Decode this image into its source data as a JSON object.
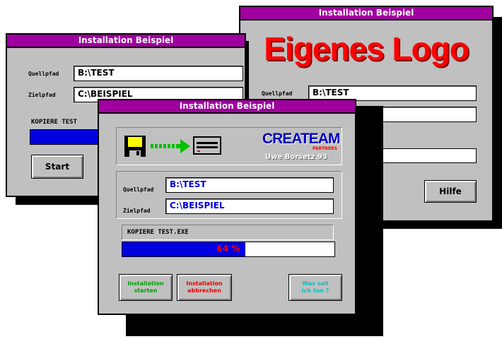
{
  "win_back_left": {
    "title": "Installation Beispiel",
    "source_label": "Quellpfad",
    "source_value": "B:\\TEST",
    "target_label": "Zielpfad",
    "target_value": "C:\\BEISPIEL",
    "status": "KOPIERE TEST",
    "start_label": "Start"
  },
  "win_back_right": {
    "title": "Installation Beispiel",
    "logo_text": "Eigenes Logo",
    "source_label": "Quellpfad",
    "source_value": "B:\\TEST",
    "progress_text": "%",
    "help_label": "Hilfe"
  },
  "win_front": {
    "title": "Installation Beispiel",
    "brand_name": "CREATEAM",
    "brand_tag": "PARTNERS",
    "brand_sub": "Uwe Borsetz 93",
    "source_label": "Quellpfad",
    "source_value": "B:\\TEST",
    "target_label": "Zielpfad",
    "target_value": "C:\\BEISPIEL",
    "status": "KOPIERE TEST.EXE",
    "progress_text": "64 %",
    "progress_value": 0.64,
    "btn_start_line1": "Installation",
    "btn_start_line2": "starten",
    "btn_abort_line1": "Installation",
    "btn_abort_line2": "abbrechen",
    "btn_help_line1": "Was soll",
    "btn_help_line2": "ich tun ?"
  },
  "colors": {
    "titlebar": "#a000a0",
    "progress": "#0000e0",
    "logo": "#ff0000",
    "shadow": "#000000",
    "btn_start_text": "#00a000",
    "btn_abort_text": "#e00000",
    "btn_help_text": "#00c0c0"
  },
  "icons": [
    "floppy-disk-icon",
    "green-arrow-icon",
    "hard-drive-icon"
  ]
}
